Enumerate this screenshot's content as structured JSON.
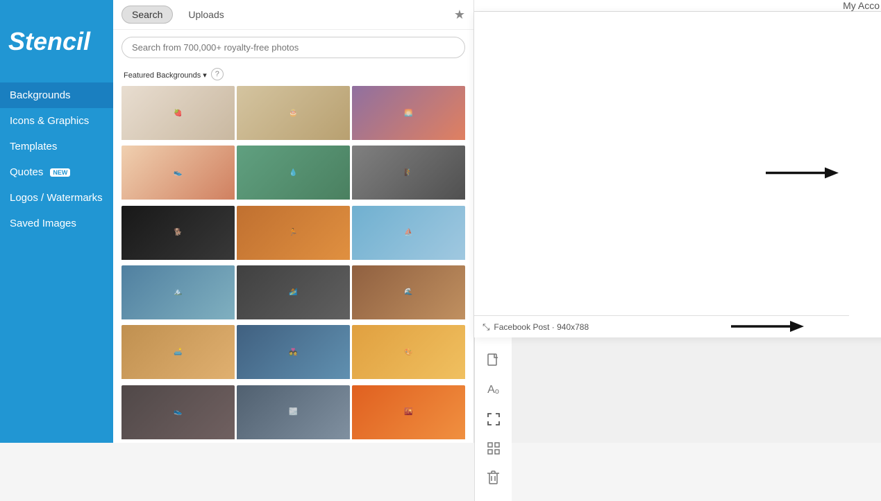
{
  "app": {
    "logo": "Stencil",
    "my_account_label": "My Acco"
  },
  "sidebar": {
    "items": [
      {
        "id": "backgrounds",
        "label": "Backgrounds",
        "active": true,
        "badge": null
      },
      {
        "id": "icons-graphics",
        "label": "Icons & Graphics",
        "active": false,
        "badge": null
      },
      {
        "id": "templates",
        "label": "Templates",
        "active": false,
        "badge": null
      },
      {
        "id": "quotes",
        "label": "Quotes",
        "active": false,
        "badge": "NEW"
      },
      {
        "id": "logos-watermarks",
        "label": "Logos / Watermarks",
        "active": false,
        "badge": null
      },
      {
        "id": "saved-images",
        "label": "Saved Images",
        "active": false,
        "badge": null
      }
    ]
  },
  "tabs": [
    {
      "id": "search",
      "label": "Search",
      "active": true
    },
    {
      "id": "uploads",
      "label": "Uploads",
      "active": false
    }
  ],
  "search": {
    "placeholder": "Search from 700,000+ royalty-free photos"
  },
  "featured": {
    "title": "Featured Backgrounds",
    "chevron": "▾"
  },
  "canvas": {
    "size_label": "Facebook Post · 940x788"
  },
  "toolbar": {
    "icons": [
      {
        "id": "document",
        "symbol": "☐",
        "label": "document-icon"
      },
      {
        "id": "text",
        "symbol": "Aₒ",
        "label": "text-icon"
      },
      {
        "id": "expand",
        "symbol": "⤡",
        "label": "expand-icon",
        "active": true
      },
      {
        "id": "grid",
        "symbol": "⊞",
        "label": "grid-icon"
      },
      {
        "id": "trash",
        "symbol": "🗑",
        "label": "trash-icon"
      }
    ]
  },
  "image_grid": [
    {
      "id": 1,
      "color": "#d4c5b5",
      "desc": "strawberry bowl"
    },
    {
      "id": 2,
      "color": "#c8b89a",
      "desc": "cake"
    },
    {
      "id": 3,
      "color": "#a0899e",
      "desc": "sunset silhouette"
    },
    {
      "id": 4,
      "color": "#e8d5c0",
      "desc": "sneaker close-up"
    },
    {
      "id": 5,
      "color": "#7a9e8e",
      "desc": "waterfall"
    },
    {
      "id": 6,
      "color": "#888",
      "desc": "zipline"
    },
    {
      "id": 7,
      "color": "#222",
      "desc": "white dog"
    },
    {
      "id": 8,
      "color": "#c8722a",
      "desc": "runners track"
    },
    {
      "id": 9,
      "color": "#7ab4d4",
      "desc": "dock clouds"
    },
    {
      "id": 10,
      "color": "#6a8aaa",
      "desc": "mountain lake"
    },
    {
      "id": 11,
      "color": "#555",
      "desc": "surfer"
    },
    {
      "id": 12,
      "color": "#a08060",
      "desc": "pier sunset"
    },
    {
      "id": 13,
      "color": "#c0a060",
      "desc": "couple bench"
    },
    {
      "id": 14,
      "color": "#5a7090",
      "desc": "couple silhouette"
    },
    {
      "id": 15,
      "color": "#e09040",
      "desc": "colorful steps"
    },
    {
      "id": 16,
      "color": "#6a6060",
      "desc": "sneakers"
    },
    {
      "id": 17,
      "color": "#7090a0",
      "desc": "person clouds"
    },
    {
      "id": 18,
      "color": "#e06020",
      "desc": "sunset arms"
    }
  ]
}
